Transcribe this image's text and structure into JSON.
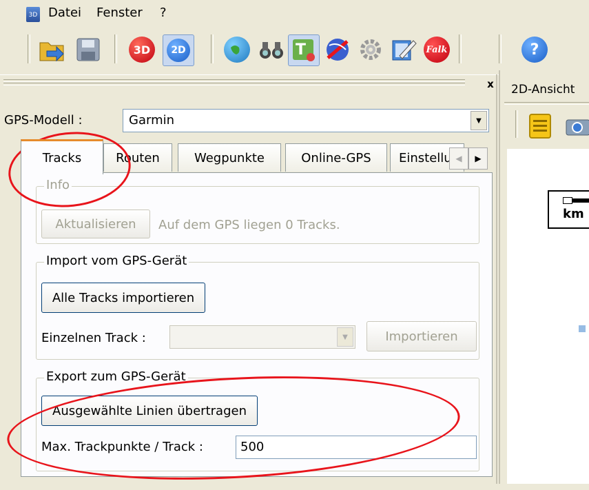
{
  "menubar": {
    "app_icon": "3D",
    "items": [
      "Datei",
      "Fenster",
      "?"
    ]
  },
  "toolbar": {
    "icons": [
      "open-folder-icon",
      "save-disk-icon",
      "3d-view-icon",
      "2d-view-icon",
      "globe-icon",
      "binoculars-icon",
      "gps-tools-icon",
      "gps-off-icon",
      "gear-icon",
      "edit-notepad-icon",
      "falk-icon",
      "help-icon"
    ],
    "label_3d": "3D",
    "label_2d": "2D",
    "label_falk": "Falk",
    "label_help": "?"
  },
  "panel": {
    "close_label": "x",
    "gps_model_label": "GPS-Modell :",
    "gps_model_value": "Garmin",
    "tabs": [
      "Tracks",
      "Routen",
      "Wegpunkte",
      "Online-GPS",
      "Einstellu"
    ],
    "info": {
      "title": "Info",
      "refresh_button": "Aktualisieren",
      "status_text": "Auf dem GPS liegen  0 Tracks."
    },
    "import": {
      "title": "Import vom GPS-Gerät",
      "import_all_button": "Alle Tracks importieren",
      "single_track_label": "Einzelnen Track :",
      "import_button": "Importieren"
    },
    "export": {
      "title": "Export zum GPS-Gerät",
      "transfer_button": "Ausgewählte Linien übertragen",
      "max_points_label": "Max. Trackpunkte / Track :",
      "max_points_value": "500"
    }
  },
  "right": {
    "tab_label": "2D-Ansicht",
    "scale_label": "km"
  },
  "annotation_color": "#e8141b"
}
